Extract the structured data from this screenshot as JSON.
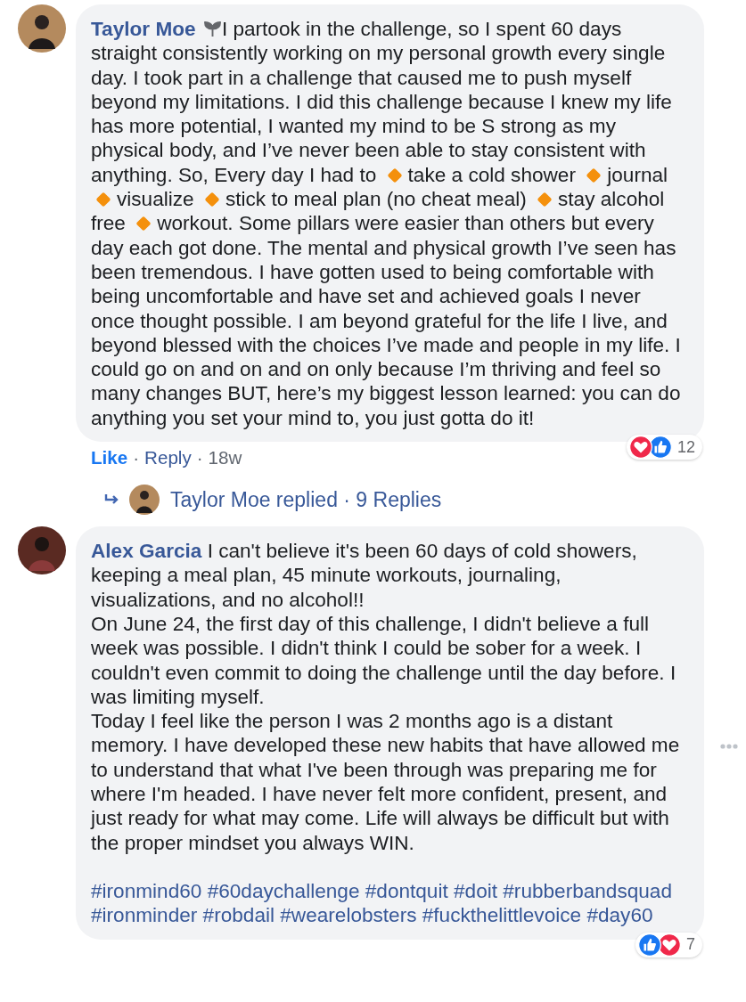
{
  "comments": [
    {
      "author": "Taylor Moe",
      "author_badge": true,
      "show_options": false,
      "paragraphs": [
        [
          {
            "kind": "text",
            "text": "I partook in the challenge, so I spent 60 days straight consistently working on my personal growth every single day. I took part in a challenge that caused me to push myself beyond my limitations. I did this challenge because I knew my life has more potential, I wanted my mind to be S strong as my physical body, and I’ve never been able to stay consistent with anything. So, Every day I had to "
          },
          {
            "kind": "diamond"
          },
          {
            "kind": "text",
            "text": "take a cold shower "
          },
          {
            "kind": "diamond"
          },
          {
            "kind": "text",
            "text": "journal "
          },
          {
            "kind": "diamond"
          },
          {
            "kind": "text",
            "text": "visualize "
          },
          {
            "kind": "diamond"
          },
          {
            "kind": "text",
            "text": "stick to meal plan (no cheat meal) "
          },
          {
            "kind": "diamond"
          },
          {
            "kind": "text",
            "text": "stay alcohol free "
          },
          {
            "kind": "diamond"
          },
          {
            "kind": "text",
            "text": "workout. Some pillars were easier than others but every day each got done. The mental and physical growth I’ve seen has been tremendous. I have gotten used to being comfortable with being uncomfortable and have set and achieved goals I never once thought possible. I am beyond grateful for the life I live, and beyond blessed with the choices I’ve made and people in my life. I could go on and on and on only because I’m thriving and feel so many changes BUT, here’s my biggest lesson learned: you can do anything you set your mind to, you just gotta do it!"
          }
        ]
      ],
      "reactions": {
        "icons": [
          {
            "kind": "love"
          },
          {
            "kind": "like"
          }
        ],
        "count": "12"
      },
      "actions": [
        {
          "kind": "like",
          "text": "Like",
          "selected": true
        },
        {
          "kind": "sep",
          "text": "·"
        },
        {
          "kind": "reply",
          "text": "Reply"
        },
        {
          "kind": "sep",
          "text": "·"
        },
        {
          "kind": "time",
          "text": "18w"
        }
      ],
      "replies": {
        "text": "Taylor Moe replied · 9 Replies"
      }
    },
    {
      "author": "Alex Garcia",
      "author_badge": false,
      "show_options": true,
      "paragraphs": [
        [
          {
            "kind": "text",
            "text": "I can't believe it's been 60 days of cold showers, keeping a meal plan, 45 minute workouts, journaling, visualizations, and no alcohol!!"
          }
        ],
        [
          {
            "kind": "text",
            "text": "On June 24, the first day of this challenge, I didn't believe a full week was possible. I didn't think I could be sober for a week. I couldn't even commit to doing the challenge until the day before. I was limiting myself."
          }
        ],
        [
          {
            "kind": "text",
            "text": "Today I feel like the person I was 2 months ago is a distant memory. I have developed these new habits that have allowed me to understand that what I've been through was preparing me for where I'm headed. I have never felt more confident, present, and just ready for what may come. Life will always be difficult but with the proper mindset you always WIN."
          }
        ]
      ],
      "hashtags": [
        "#ironmind60",
        "#60daychallenge",
        "#dontquit",
        "#doit",
        "#rubberbandsquad",
        "#ironminder",
        "#robdail",
        "#wearelobsters",
        "#fuckthelittlevoice",
        "#day60"
      ],
      "reactions": {
        "icons": [
          {
            "kind": "like"
          },
          {
            "kind": "love"
          }
        ],
        "count": "7"
      }
    }
  ]
}
